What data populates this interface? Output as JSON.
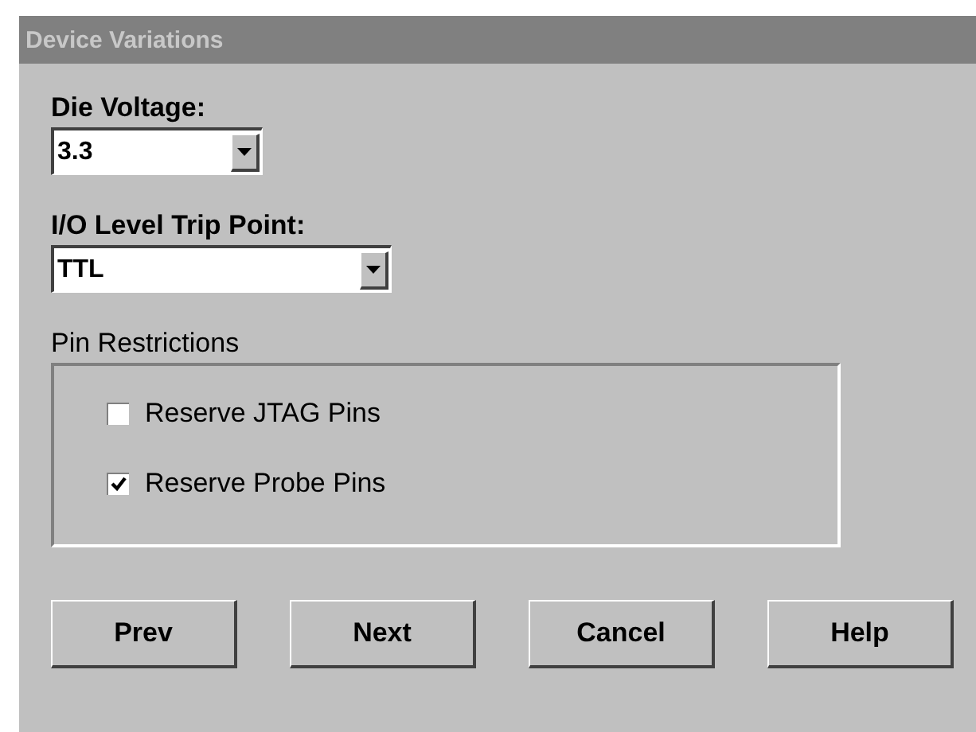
{
  "window": {
    "title": "Device Variations"
  },
  "die_voltage": {
    "label": "Die Voltage:",
    "value": "3.3"
  },
  "io_level": {
    "label": "I/O Level Trip Point:",
    "value": "TTL"
  },
  "pin_restrictions": {
    "label": "Pin Restrictions",
    "options": [
      {
        "label": "Reserve JTAG Pins",
        "checked": false
      },
      {
        "label": "Reserve Probe Pins",
        "checked": true
      }
    ]
  },
  "buttons": [
    "Prev",
    "Next",
    "Cancel",
    "Help"
  ]
}
